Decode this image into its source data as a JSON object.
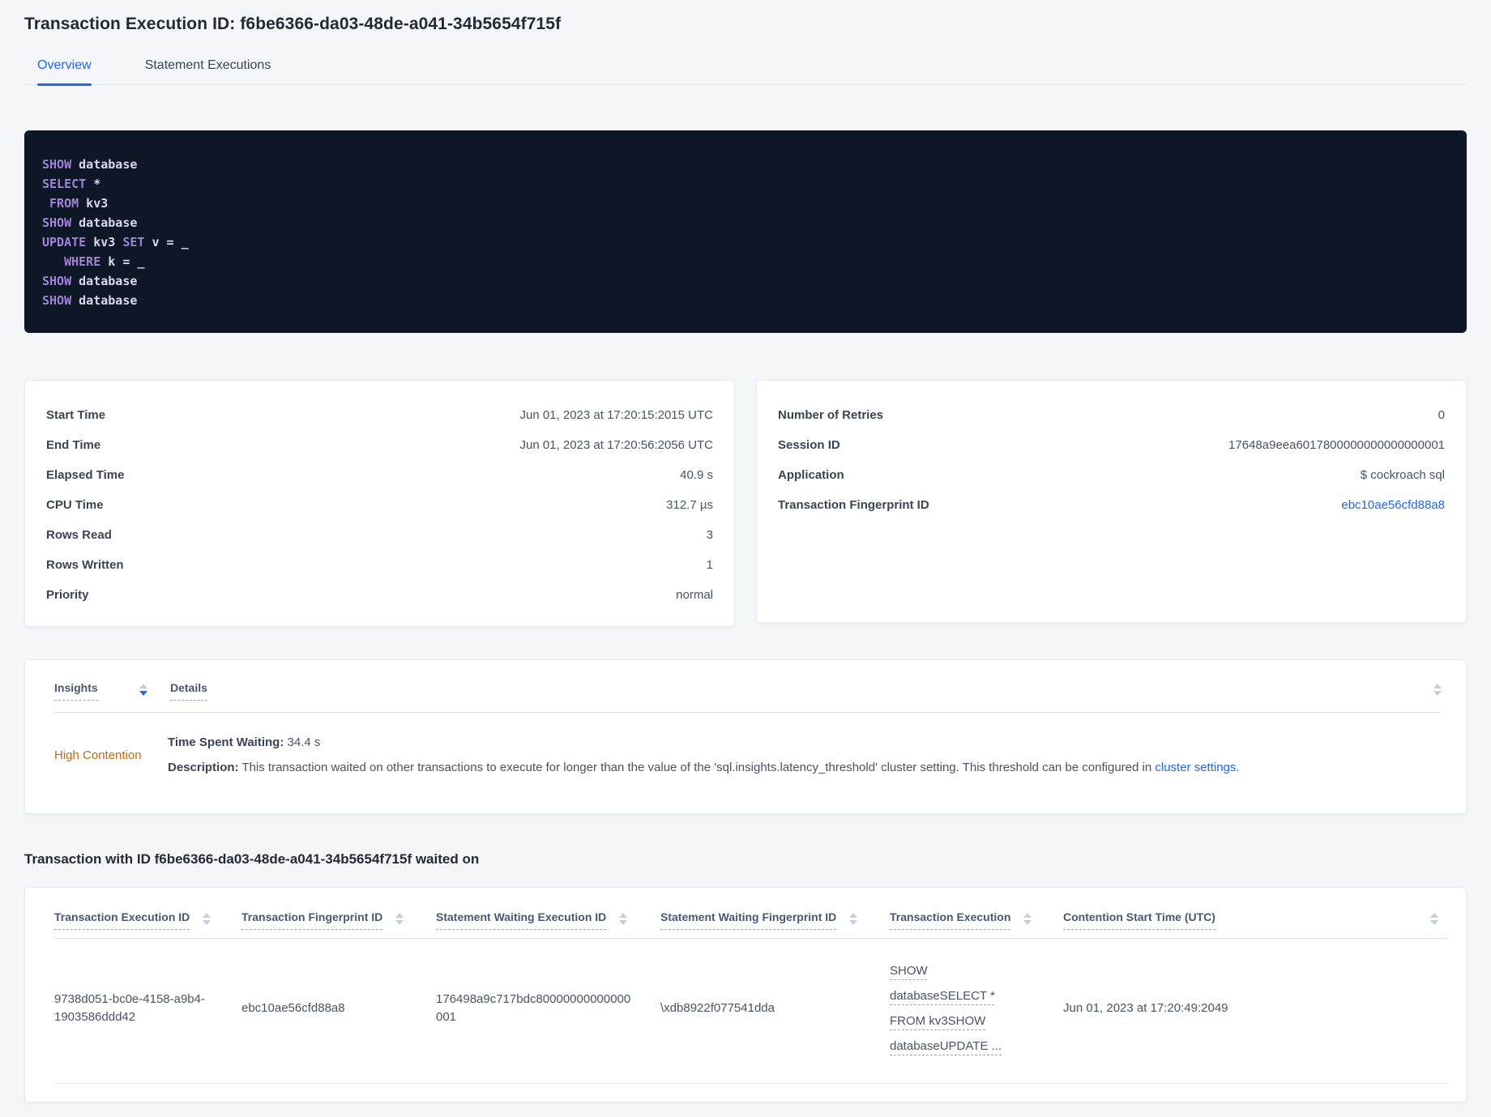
{
  "page": {
    "title": "Transaction Execution ID: f6be6366-da03-48de-a041-34b5654f715f"
  },
  "tabs": [
    {
      "label": "Overview",
      "active": true
    },
    {
      "label": "Statement Executions",
      "active": false
    }
  ],
  "sql_lines": [
    [
      [
        "kw",
        "SHOW"
      ],
      [
        "pl",
        " database"
      ]
    ],
    [
      [
        "kw",
        "SELECT"
      ],
      [
        "pl",
        " *"
      ]
    ],
    [
      [
        "pl",
        " "
      ],
      [
        "kw",
        "FROM"
      ],
      [
        "pl",
        " kv3"
      ]
    ],
    [
      [
        "kw",
        "SHOW"
      ],
      [
        "pl",
        " database"
      ]
    ],
    [
      [
        "kw",
        "UPDATE"
      ],
      [
        "pl",
        " kv3 "
      ],
      [
        "kw",
        "SET"
      ],
      [
        "pl",
        " v = _"
      ]
    ],
    [
      [
        "pl",
        "   "
      ],
      [
        "kw",
        "WHERE"
      ],
      [
        "pl",
        " k = _"
      ]
    ],
    [
      [
        "kw",
        "SHOW"
      ],
      [
        "pl",
        " database"
      ]
    ],
    [
      [
        "kw",
        "SHOW"
      ],
      [
        "pl",
        " database"
      ]
    ]
  ],
  "overview_card": {
    "rows": [
      {
        "label": "Start Time",
        "value": "Jun 01, 2023 at 17:20:15:2015 UTC"
      },
      {
        "label": "End Time",
        "value": "Jun 01, 2023 at 17:20:56:2056 UTC"
      },
      {
        "label": "Elapsed Time",
        "value": "40.9 s"
      },
      {
        "label": "CPU Time",
        "value": "312.7 µs"
      },
      {
        "label": "Rows Read",
        "value": "3"
      },
      {
        "label": "Rows Written",
        "value": "1"
      },
      {
        "label": "Priority",
        "value": "normal"
      }
    ]
  },
  "session_card": {
    "rows": [
      {
        "label": "Number of Retries",
        "value": "0"
      },
      {
        "label": "Session ID",
        "value": "17648a9eea6017800000000000000001"
      },
      {
        "label": "Application",
        "value": "$ cockroach sql"
      },
      {
        "label": "Transaction Fingerprint ID",
        "value": "ebc10ae56cfd88a8",
        "link": true
      }
    ]
  },
  "insights_table": {
    "col_insights": "Insights",
    "col_details": "Details",
    "row": {
      "insight": "High Contention",
      "waiting_label": "Time Spent Waiting:",
      "waiting_value": " 34.4 s",
      "description_label": "Description:",
      "description_text": " This transaction waited on other transactions to execute for longer than the value of the 'sql.insights.latency_threshold' cluster setting. This threshold can be configured in ",
      "description_link": "cluster settings",
      "description_suffix": "."
    }
  },
  "waited_on": {
    "heading": "Transaction with ID f6be6366-da03-48de-a041-34b5654f715f waited on",
    "columns": [
      "Transaction Execution ID",
      "Transaction Fingerprint ID",
      "Statement Waiting Execution ID",
      "Statement Waiting Fingerprint ID",
      "Transaction Execution",
      "Contention Start Time (UTC)"
    ],
    "rows": [
      {
        "transaction_execution_id": "9738d051-bc0e-4158-a9b4-1903586ddd42",
        "transaction_fingerprint_id": "ebc10ae56cfd88a8",
        "statement_waiting_execution_id": "176498a9c717bdc80000000000000001",
        "statement_waiting_fingerprint_id": "\\xdb8922f077541dda",
        "transaction_execution": "SHOW databaseSELECT * FROM kv3SHOW databaseUPDATE ...",
        "contention_start_time": "Jun 01, 2023 at 17:20:49:2049"
      }
    ]
  },
  "colors": {
    "accent_blue": "#2166f0",
    "insight_orange": "#c2690f",
    "code_background": "#0e1726",
    "code_keyword": "#a184d8",
    "code_text": "#dcd6f3",
    "page_background": "#f4f6fa"
  }
}
